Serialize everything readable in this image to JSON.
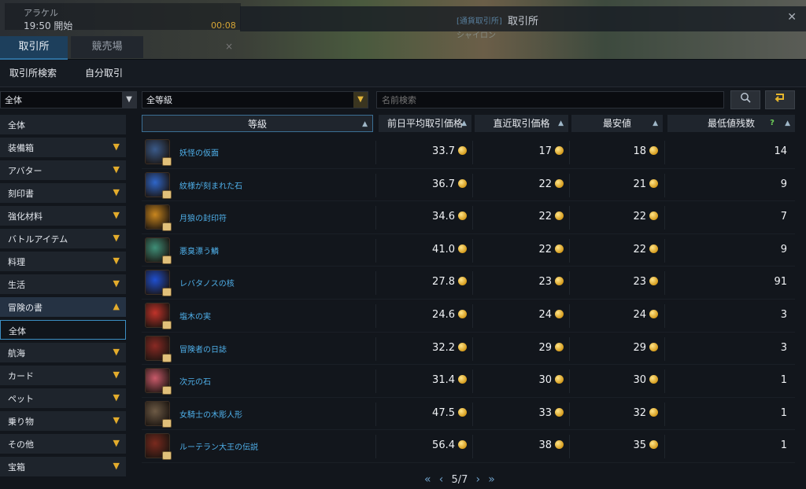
{
  "hud": {
    "name": "アラケル",
    "time": "19:50 開始",
    "count": "00:08",
    "close": "×"
  },
  "window": {
    "title": "取引所",
    "close_icon": "close-icon",
    "ghost1": "[通貨取引所]",
    "ghost2": "シャイロン"
  },
  "tabs": [
    {
      "label": "取引所",
      "active": true
    },
    {
      "label": "競売場",
      "active": false
    }
  ],
  "subtabs": [
    {
      "label": "取引所検索",
      "active": true
    },
    {
      "label": "自分取引",
      "active": false
    }
  ],
  "filters": {
    "category_value": "全体",
    "grade_value": "全等級",
    "search_placeholder": "名前検索",
    "search_icon": "search-icon",
    "reset_icon": "reset-arrow-icon"
  },
  "sidebar": {
    "items": [
      {
        "label": "全体",
        "chevron": ""
      },
      {
        "label": "装備箱",
        "chevron": "▼"
      },
      {
        "label": "アバター",
        "chevron": "▼"
      },
      {
        "label": "刻印書",
        "chevron": "▼"
      },
      {
        "label": "強化材料",
        "chevron": "▼"
      },
      {
        "label": "バトルアイテム",
        "chevron": "▼"
      },
      {
        "label": "料理",
        "chevron": "▼"
      },
      {
        "label": "生活",
        "chevron": "▼"
      },
      {
        "label": "冒険の書",
        "chevron": "▲"
      },
      {
        "label": "全体",
        "chevron": ""
      },
      {
        "label": "航海",
        "chevron": "▼"
      },
      {
        "label": "カード",
        "chevron": "▼"
      },
      {
        "label": "ペット",
        "chevron": "▼"
      },
      {
        "label": "乗り物",
        "chevron": "▼"
      },
      {
        "label": "その他",
        "chevron": "▼"
      },
      {
        "label": "宝箱",
        "chevron": "▼"
      }
    ]
  },
  "table": {
    "headers": {
      "grade": "等級",
      "prev_avg": "前日平均取引価格",
      "recent": "直近取引価格",
      "lowest": "最安値",
      "lowest_count": "最低値残数",
      "help": "?",
      "sort_icon": "▲"
    },
    "rows": [
      {
        "name": "妖怪の仮面",
        "prev_avg": "33.7",
        "recent": "17",
        "lowest": "18",
        "count": "14",
        "color": "#3a5a8a"
      },
      {
        "name": "紋様が刻まれた石",
        "prev_avg": "36.7",
        "recent": "22",
        "lowest": "21",
        "count": "9",
        "color": "#2f66c9"
      },
      {
        "name": "月狼の封印符",
        "prev_avg": "34.6",
        "recent": "22",
        "lowest": "22",
        "count": "7",
        "color": "#c9861e"
      },
      {
        "name": "悪臭漂う鱗",
        "prev_avg": "41.0",
        "recent": "22",
        "lowest": "22",
        "count": "9",
        "color": "#3f8f78"
      },
      {
        "name": "レバタノスの核",
        "prev_avg": "27.8",
        "recent": "23",
        "lowest": "23",
        "count": "91",
        "color": "#1f4fd0"
      },
      {
        "name": "塩木の実",
        "prev_avg": "24.6",
        "recent": "24",
        "lowest": "24",
        "count": "3",
        "color": "#c0332a"
      },
      {
        "name": "冒険者の日誌",
        "prev_avg": "32.2",
        "recent": "29",
        "lowest": "29",
        "count": "3",
        "color": "#8a2a24"
      },
      {
        "name": "次元の石",
        "prev_avg": "31.4",
        "recent": "30",
        "lowest": "30",
        "count": "1",
        "color": "#c95a6a"
      },
      {
        "name": "女騎士の木彫人形",
        "prev_avg": "47.5",
        "recent": "33",
        "lowest": "32",
        "count": "1",
        "color": "#6d5a45"
      },
      {
        "name": "ルーテラン大王の伝説",
        "prev_avg": "56.4",
        "recent": "38",
        "lowest": "35",
        "count": "1",
        "color": "#7a2a1e"
      }
    ]
  },
  "pager": {
    "first": "«",
    "prev": "‹",
    "page": "5/7",
    "next": "›",
    "last": "»"
  }
}
